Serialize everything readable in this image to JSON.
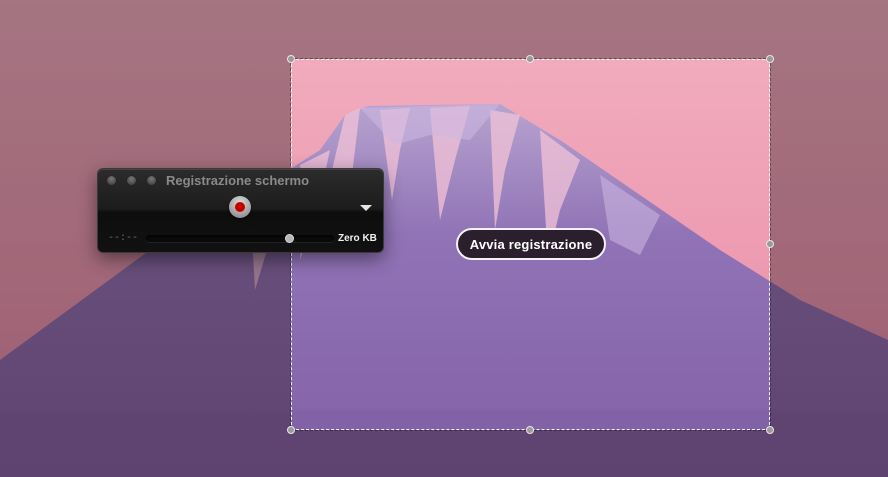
{
  "hud": {
    "title": "Registrazione schermo",
    "elapsed_time": "--:--",
    "file_size": "Zero KB",
    "volume_level": 0.76,
    "record_color": "#c40000",
    "icons": [
      "close-icon",
      "minimize-icon",
      "zoom-icon",
      "record-icon",
      "options-chevron-icon"
    ]
  },
  "selection": {
    "start_label": "Avvia registrazione"
  },
  "colors": {
    "sky_top": "#f0a8c0",
    "sky_bottom": "#e88aa8",
    "mountain": "#8a6bb0",
    "dim_overlay": "#281420"
  }
}
